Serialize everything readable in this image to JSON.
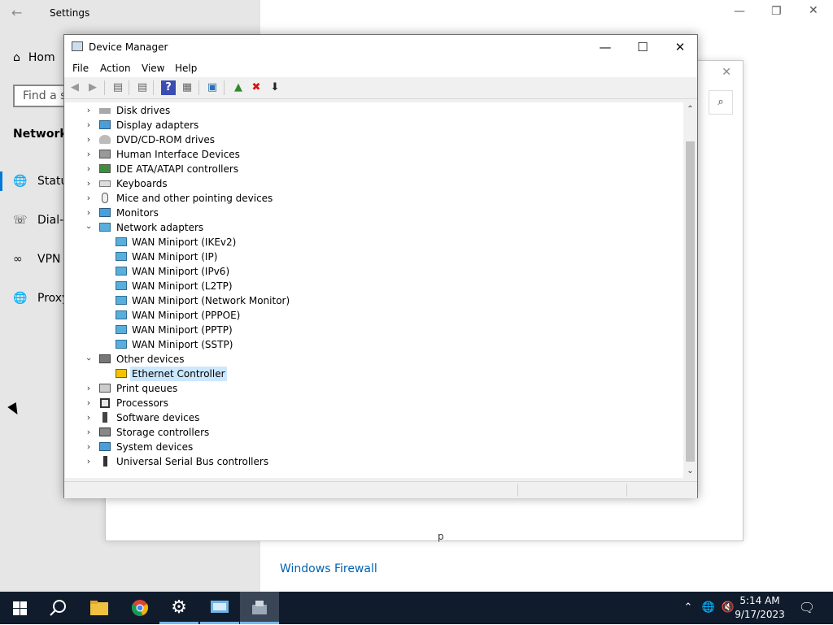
{
  "settings": {
    "title": "Settings",
    "home_label": "Hom",
    "search_placeholder": "Find a se",
    "section_title": "Network &",
    "nav": [
      {
        "label": "Statu",
        "icon": "globe-icon"
      },
      {
        "label": "Dial-u",
        "icon": "dialup-icon"
      },
      {
        "label": "VPN",
        "icon": "vpn-icon"
      },
      {
        "label": "Proxy",
        "icon": "globe-icon"
      }
    ],
    "windows_firewall_link": "Windows Firewall",
    "partial_text": "p"
  },
  "device_manager": {
    "title": "Device Manager",
    "menu": [
      "File",
      "Action",
      "View",
      "Help"
    ],
    "tree": [
      {
        "label": "Disk drives",
        "expanded": false,
        "level": 1,
        "icon": "disk-icon"
      },
      {
        "label": "Display adapters",
        "expanded": false,
        "level": 1,
        "icon": "display-icon"
      },
      {
        "label": "DVD/CD-ROM drives",
        "expanded": false,
        "level": 1,
        "icon": "dvd-icon"
      },
      {
        "label": "Human Interface Devices",
        "expanded": false,
        "level": 1,
        "icon": "hid-icon"
      },
      {
        "label": "IDE ATA/ATAPI controllers",
        "expanded": false,
        "level": 1,
        "icon": "ide-icon"
      },
      {
        "label": "Keyboards",
        "expanded": false,
        "level": 1,
        "icon": "keyboard-icon"
      },
      {
        "label": "Mice and other pointing devices",
        "expanded": false,
        "level": 1,
        "icon": "mouse-icon"
      },
      {
        "label": "Monitors",
        "expanded": false,
        "level": 1,
        "icon": "monitor-icon"
      },
      {
        "label": "Network adapters",
        "expanded": true,
        "level": 1,
        "icon": "network-icon"
      },
      {
        "label": "WAN Miniport (IKEv2)",
        "level": 2,
        "icon": "network-icon"
      },
      {
        "label": "WAN Miniport (IP)",
        "level": 2,
        "icon": "network-icon"
      },
      {
        "label": "WAN Miniport (IPv6)",
        "level": 2,
        "icon": "network-icon"
      },
      {
        "label": "WAN Miniport (L2TP)",
        "level": 2,
        "icon": "network-icon"
      },
      {
        "label": "WAN Miniport (Network Monitor)",
        "level": 2,
        "icon": "network-icon"
      },
      {
        "label": "WAN Miniport (PPPOE)",
        "level": 2,
        "icon": "network-icon"
      },
      {
        "label": "WAN Miniport (PPTP)",
        "level": 2,
        "icon": "network-icon"
      },
      {
        "label": "WAN Miniport (SSTP)",
        "level": 2,
        "icon": "network-icon"
      },
      {
        "label": "Other devices",
        "expanded": true,
        "level": 1,
        "icon": "unknown-device-icon"
      },
      {
        "label": "Ethernet Controller",
        "level": 2,
        "icon": "warning-device-icon",
        "selected": true
      },
      {
        "label": "Print queues",
        "expanded": false,
        "level": 1,
        "icon": "printer-icon"
      },
      {
        "label": "Processors",
        "expanded": false,
        "level": 1,
        "icon": "processor-icon"
      },
      {
        "label": "Software devices",
        "expanded": false,
        "level": 1,
        "icon": "software-device-icon"
      },
      {
        "label": "Storage controllers",
        "expanded": false,
        "level": 1,
        "icon": "storage-icon"
      },
      {
        "label": "System devices",
        "expanded": false,
        "level": 1,
        "icon": "system-icon"
      },
      {
        "label": "Universal Serial Bus controllers",
        "expanded": false,
        "level": 1,
        "icon": "usb-icon"
      }
    ]
  },
  "taskbar": {
    "time": "5:14 AM",
    "date": "9/17/2023"
  },
  "colors": {
    "accent": "#0078d7",
    "taskbar": "#101c2c",
    "selection": "#cce8ff",
    "link": "#0063b1"
  }
}
